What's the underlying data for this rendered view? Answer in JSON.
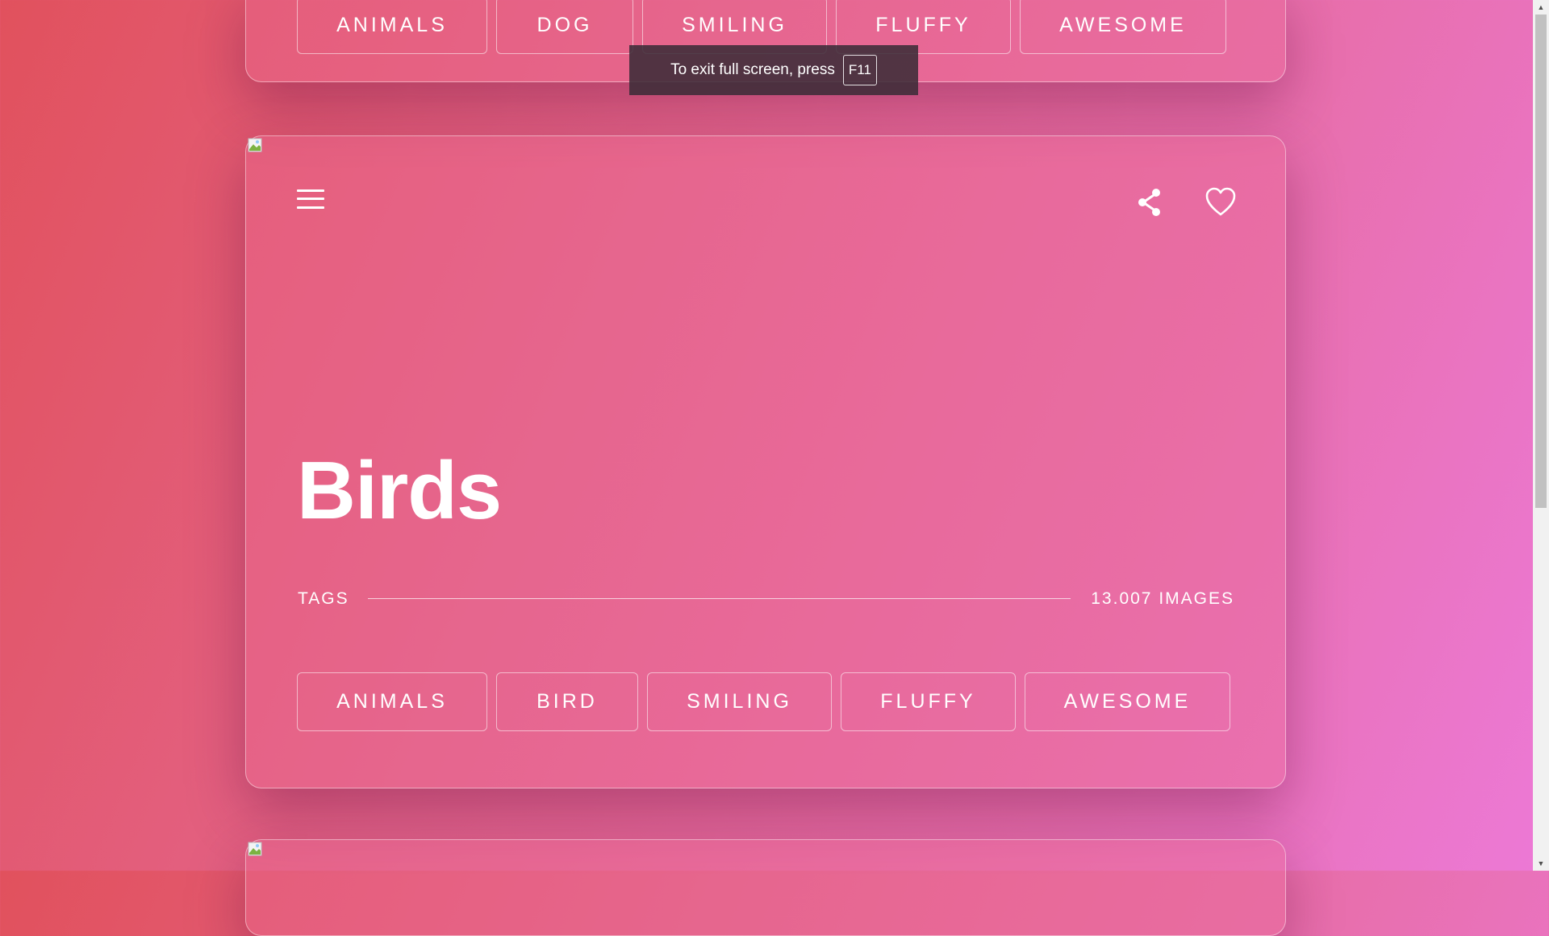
{
  "fullscreen_notice": {
    "text": "To exit full screen, press",
    "key": "F11"
  },
  "top_card": {
    "tags": [
      {
        "label": "ANIMALS"
      },
      {
        "label": "DOG"
      },
      {
        "label": "SMILING"
      },
      {
        "label": "FLUFFY"
      },
      {
        "label": "AWESOME"
      }
    ]
  },
  "main_card": {
    "title": "Birds",
    "tags_label": "TAGS",
    "images_count": "13.007 IMAGES",
    "icons": {
      "menu": "hamburger-menu-icon",
      "share": "share-icon",
      "favorite": "heart-icon"
    },
    "tags": [
      {
        "label": "ANIMALS"
      },
      {
        "label": "BIRD"
      },
      {
        "label": "SMILING"
      },
      {
        "label": "FLUFFY"
      },
      {
        "label": "AWESOME"
      }
    ]
  },
  "theme": {
    "gradient_start": "#e1515d",
    "gradient_end": "#ec79d6",
    "text_color": "#ffffff"
  }
}
